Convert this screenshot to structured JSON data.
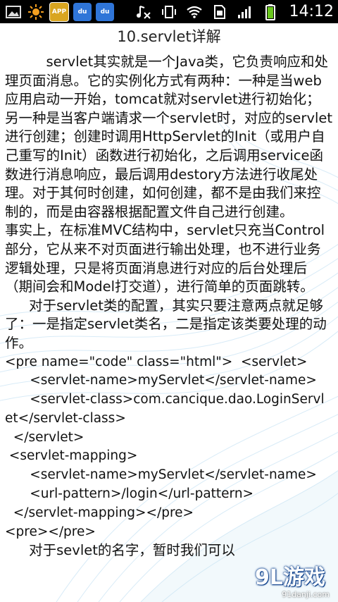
{
  "status_bar": {
    "clock": "14:12",
    "apps": [
      {
        "icon": "gallery-icon"
      },
      {
        "icon": "sun-icon"
      },
      {
        "icon": "app-market-icon",
        "label": "APP"
      },
      {
        "icon": "baidu-icon",
        "label": "du"
      },
      {
        "icon": "baidu-icon",
        "label": "du"
      }
    ],
    "indicators": [
      "music-off-icon",
      "vibrate-icon",
      "wifi-icon",
      "sim-icon",
      "signal-icon",
      "battery-icon"
    ]
  },
  "article": {
    "title": "10.servlet详解",
    "paragraphs": [
      "servlet其实就是一个Java类，它负责响应和处理页面消息。它的实例化方式有两种：一种是当web应用启动一开始，tomcat就对servlet进行初始化；另一种是当客户端请求一个servlet时，对应的servlet进行创建；创建时调用HttpServlet的Init（或用户自己重写的Init）函数进行初始化，之后调用service函数进行消息响应，最后调用destory方法进行收尾处理。对于其何时创建，如何创建，都不是由我们来控制的，而是由容器根据配置文件自己进行创建。",
      "事实上，在标准MVC结构中，servlet只充当Control部分，它从来不对页面进行输出处理，也不进行业务逻辑处理，只是将页面消息进行对应的后台处理后（期间会和Model打交道），进行简单的页面跳转。",
      "对于servlet类的配置，其实只要注意两点就足够了：一是指定servlet类名，二是指定该类要处理的动作。"
    ],
    "code_lines": [
      "<pre name=\"code\" class=\"html\">  <servlet>",
      "      <servlet-name>myServlet</servlet-name>",
      "      <servlet-class>com.cancique.dao.LoginServl",
      "et</servlet-class>",
      "  </servlet>",
      " <servlet-mapping>",
      "      <servlet-name>myServlet</servlet-name>",
      "      <url-pattern>/login</url-pattern>",
      "  </servlet-mapping></pre>",
      "<pre></pre>"
    ],
    "last_line": "对于sevlet的名字，暂时我们可以"
  },
  "watermark": {
    "logo": "9L游戏",
    "domain": "91danji.com"
  }
}
